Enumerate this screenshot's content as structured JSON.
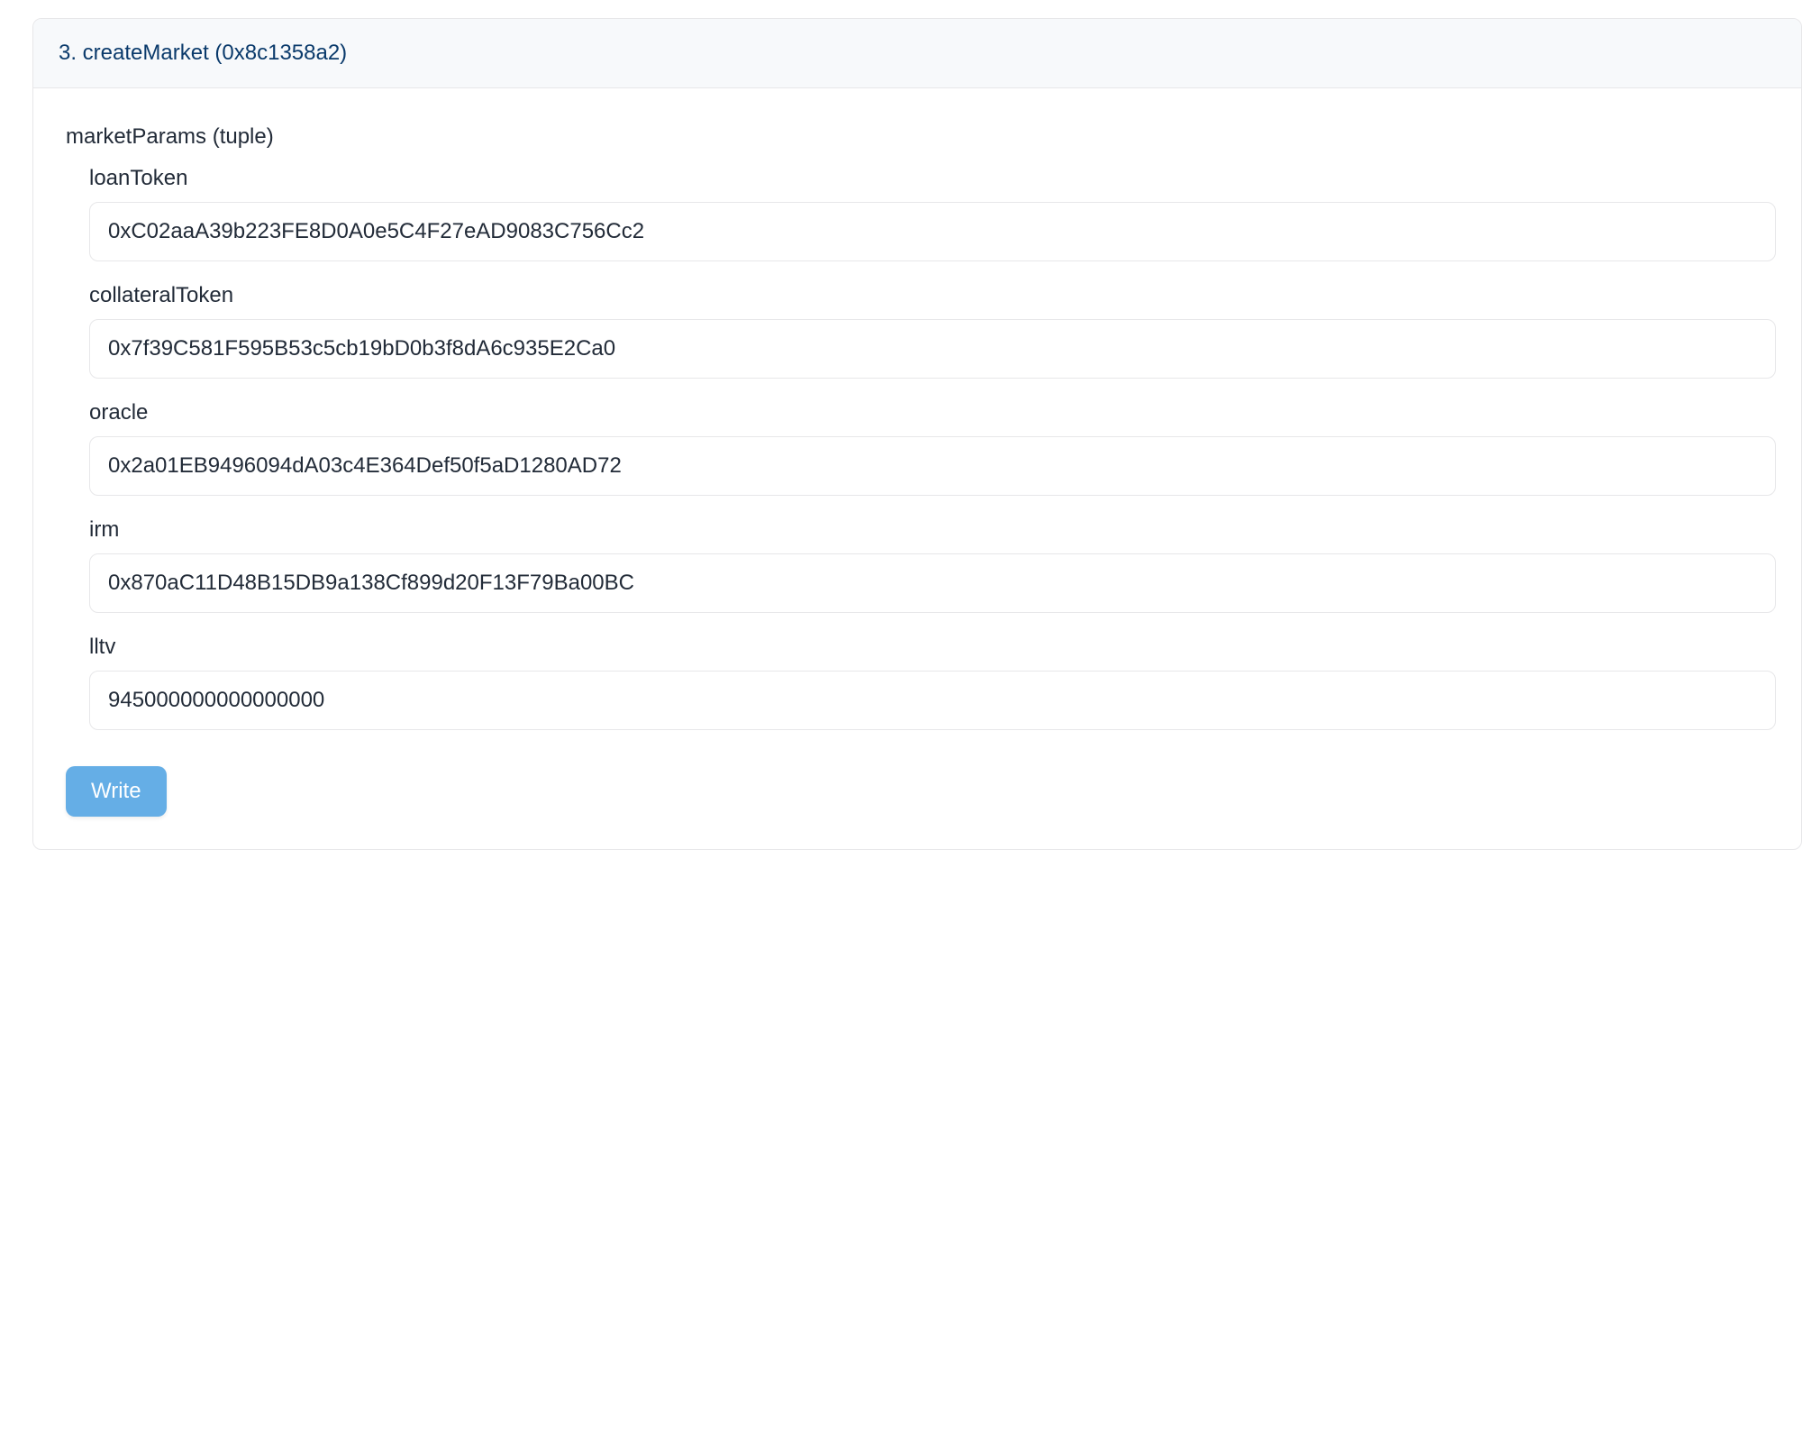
{
  "function": {
    "index": "3",
    "name": "createMarket",
    "selector": "0x8c1358a2",
    "header": "3. createMarket (0x8c1358a2)"
  },
  "tuple_label": "marketParams (tuple)",
  "params": {
    "loanToken": {
      "label": "loanToken",
      "value": "0xC02aaA39b223FE8D0A0e5C4F27eAD9083C756Cc2"
    },
    "collateralToken": {
      "label": "collateralToken",
      "value": "0x7f39C581F595B53c5cb19bD0b3f8dA6c935E2Ca0"
    },
    "oracle": {
      "label": "oracle",
      "value": "0x2a01EB9496094dA03c4E364Def50f5aD1280AD72"
    },
    "irm": {
      "label": "irm",
      "value": "0x870aC11D48B15DB9a138Cf899d20F13F79Ba00BC"
    },
    "lltv": {
      "label": "lltv",
      "value": "945000000000000000"
    }
  },
  "actions": {
    "write_label": "Write"
  }
}
